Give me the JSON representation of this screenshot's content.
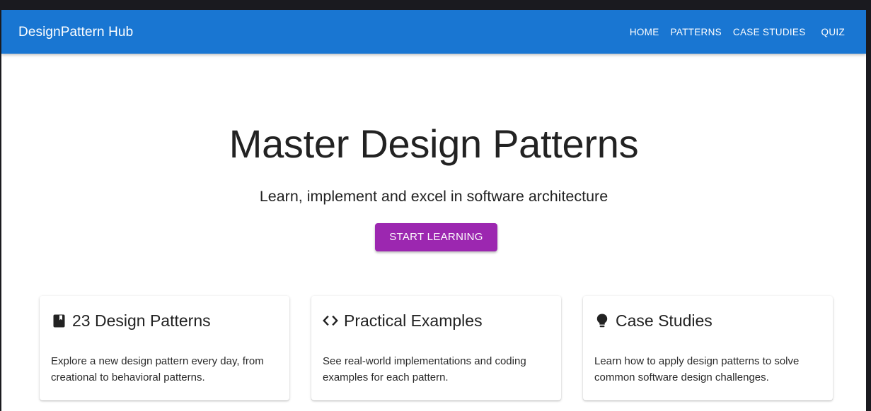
{
  "appbar": {
    "brand": "DesignPattern Hub",
    "nav": [
      "HOME",
      "PATTERNS",
      "CASE STUDIES",
      "QUIZ"
    ]
  },
  "hero": {
    "title": "Master Design Patterns",
    "subtitle": "Learn, implement and excel in software architecture",
    "cta_label": "START LEARNING"
  },
  "cards": [
    {
      "icon": "book-icon",
      "title": "23 Design Patterns",
      "text": "Explore a new design pattern every day, from creational to behavioral patterns."
    },
    {
      "icon": "code-icon",
      "title": "Practical Examples",
      "text": "See real-world implementations and coding examples for each pattern."
    },
    {
      "icon": "lightbulb-icon",
      "title": "Case Studies",
      "text": "Learn how to apply design patterns to solve common software design challenges."
    }
  ],
  "colors": {
    "appbar": "#1976d2",
    "cta": "#9c27b0",
    "text": "#222222",
    "window_bg": "#1a1a1f"
  }
}
